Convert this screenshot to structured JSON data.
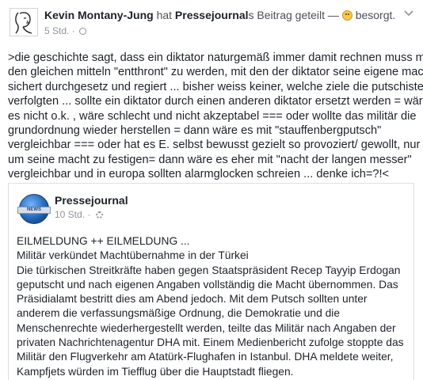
{
  "post": {
    "author": "Kevin Montany-Jung",
    "action_pre": "hat",
    "shared_page": "Pressejournal",
    "action_post": "s Beitrag geteilt —",
    "feeling": "besorgt.",
    "timestamp": "5 Std.",
    "separator": "·",
    "body_lines": [
      ">die geschichte  sagt, dass ein diktator  naturgemäß immer damit rechnen muss mit",
      "den gleichen mitteln  \"entthront\" zu werden, mit den der diktator seine eigene macht",
      "sichert durchgesetz und regiert  ... bisher weiss keiner, welche ziele die putschisten",
      "verfolgten ... sollte ein diktator durch einen anderen diktator ersetzt werden = wäre",
      "es nicht o.k.  , wäre schlecht und nicht akzeptabel  === oder wollte das militär die",
      "grundordnung wieder herstellen =  dann wäre es mit \"stauffenbergputsch\"",
      "vergleichbar === oder hat es E. selbst bewusst gezielt so provoziert/ gewollt,  nur",
      "um seine macht zu festigen= dann wäre es eher mit \"nacht der langen messer\"",
      "vergleichbar  und in europa  sollten alarmglocken schreien ... denke ich=?!<"
    ]
  },
  "shared_post": {
    "page_name": "Pressejournal",
    "logo_text": "NEWS",
    "timestamp": "10 Std.",
    "separator": "·",
    "lines": [
      "EILMELDUNG ++ EILMELDUNG ...",
      "Militär verkündet Machtübernahme in der Türkei",
      "Die türkischen Streitkräfte haben gegen Staatspräsident Recep Tayyip Erdogan",
      "geputscht und nach eigenen Angaben vollständig die Macht übernommen. Das",
      "Präsidialamt bestritt dies am Abend jedoch. Mit dem Putsch sollten unter",
      "anderem die verfassungsmäßige Ordnung, die Demokratie und die",
      "Menschenrechte wiederhergestellt werden, teilte das Militär nach Angaben der",
      "privaten Nachrichtenagentur DHA mit. Einem Medienbericht zufolge stoppte das",
      "Militär den Flugverkehr am Atatürk-Flughafen in Istanbul. DHA meldete weiter,",
      "Kampfjets würden im Tiefflug über die Hauptstadt fliegen."
    ]
  },
  "icons": {
    "avatar": "sketch-profile-avatar",
    "feeling": "worried-face-emoji",
    "privacy": "globe-icon",
    "menu": "chevron-down-icon",
    "shared_privacy": "gear-icon",
    "logo": "news-globe-logo"
  },
  "colors": {
    "text": "#1d2129",
    "muted": "#90949c",
    "border": "#dddfe2",
    "logo_blue": "#1f5fae"
  }
}
